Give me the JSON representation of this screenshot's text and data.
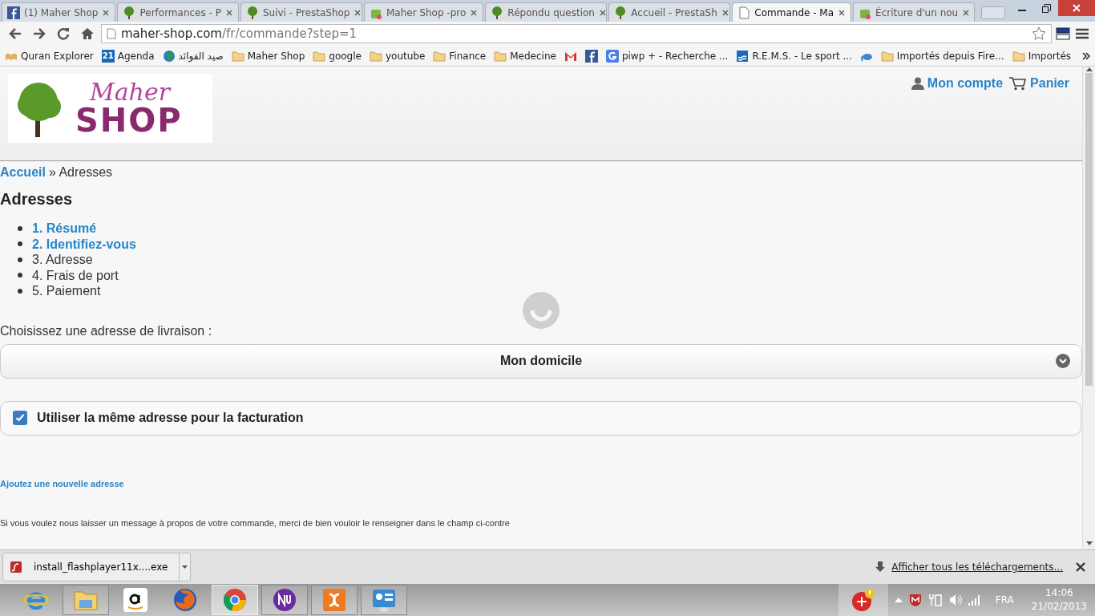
{
  "tabs": [
    {
      "kind": "facebook",
      "title": "(1) Maher Shop",
      "selected": false
    },
    {
      "kind": "tree",
      "title": "Performances - P",
      "selected": false
    },
    {
      "kind": "tree",
      "title": "Suivi - PrestaShop",
      "selected": false
    },
    {
      "kind": "bag",
      "title": "Maher Shop -pro",
      "selected": false
    },
    {
      "kind": "tree",
      "title": "Répondu question",
      "selected": false
    },
    {
      "kind": "tree",
      "title": "Accueil - PrestaSh",
      "selected": false
    },
    {
      "kind": "page",
      "title": "Commande - Ma",
      "selected": true
    },
    {
      "kind": "bag",
      "title": "Écriture d'un nou",
      "selected": false
    }
  ],
  "address": {
    "host": "maher-shop.com",
    "path": "/fr/commande?step=1"
  },
  "bookmarks": [
    {
      "kind": "book",
      "label": "Quran Explorer"
    },
    {
      "kind": "calendar",
      "badge": "21",
      "label": "Agenda"
    },
    {
      "kind": "globe",
      "label": "صيد الفوائد"
    },
    {
      "kind": "folder",
      "label": "Maher Shop"
    },
    {
      "kind": "folder",
      "label": "google"
    },
    {
      "kind": "folder",
      "label": "youtube"
    },
    {
      "kind": "folder",
      "label": "Finance"
    },
    {
      "kind": "folder",
      "label": "Medecine"
    },
    {
      "kind": "gmail"
    },
    {
      "kind": "facebook"
    },
    {
      "kind": "google",
      "label": "piwp + - Recherche ..."
    },
    {
      "kind": "rems",
      "label": "R.E.M.S. - Le sport ..."
    },
    {
      "kind": "elephant"
    },
    {
      "kind": "folder",
      "label": "Importés depuis Fire..."
    },
    {
      "kind": "folder",
      "label": "Importés"
    }
  ],
  "logo": {
    "line1": "Maher",
    "line2": "SHOP"
  },
  "account": {
    "account_link": "Mon compte",
    "cart_link": "Panier"
  },
  "breadcrumb": {
    "home": "Accueil",
    "current": "» Adresses"
  },
  "heading": "Adresses",
  "steps": [
    {
      "label": "1. Résumé",
      "done": true
    },
    {
      "label": "2. Identifiez-vous",
      "done": true
    },
    {
      "label": "3. Adresse",
      "done": false
    },
    {
      "label": "4. Frais de port",
      "done": false
    },
    {
      "label": "5. Paiement",
      "done": false
    }
  ],
  "delivery": {
    "label": "Choisissez une adresse de livraison :",
    "value": "Mon domicile"
  },
  "same_billing": {
    "label": "Utiliser la même adresse pour la facturation",
    "checked": true
  },
  "add_address_link": "Ajoutez une nouvelle adresse",
  "message_text": "Si vous voulez nous laisser un message à propos de votre commande, merci de bien vouloir le renseigner dans le champ ci-contre",
  "downloads": {
    "file": "install_flashplayer11x....exe",
    "show_all": "Afficher tous les téléchargements..."
  },
  "taskbar": {
    "apps": [
      {
        "kind": "ie",
        "running": false,
        "selected": false
      },
      {
        "kind": "explorer",
        "running": true,
        "selected": false
      },
      {
        "kind": "amazon",
        "running": false,
        "selected": false
      },
      {
        "kind": "firefox",
        "running": false,
        "selected": false
      },
      {
        "kind": "chrome",
        "running": true,
        "selected": true
      },
      {
        "kind": "nvu",
        "running": true,
        "selected": false
      },
      {
        "kind": "xampp",
        "running": true,
        "selected": false
      },
      {
        "kind": "panel",
        "running": true,
        "selected": false
      }
    ],
    "language": "FRA",
    "time": "14:06",
    "date": "21/02/2013"
  }
}
